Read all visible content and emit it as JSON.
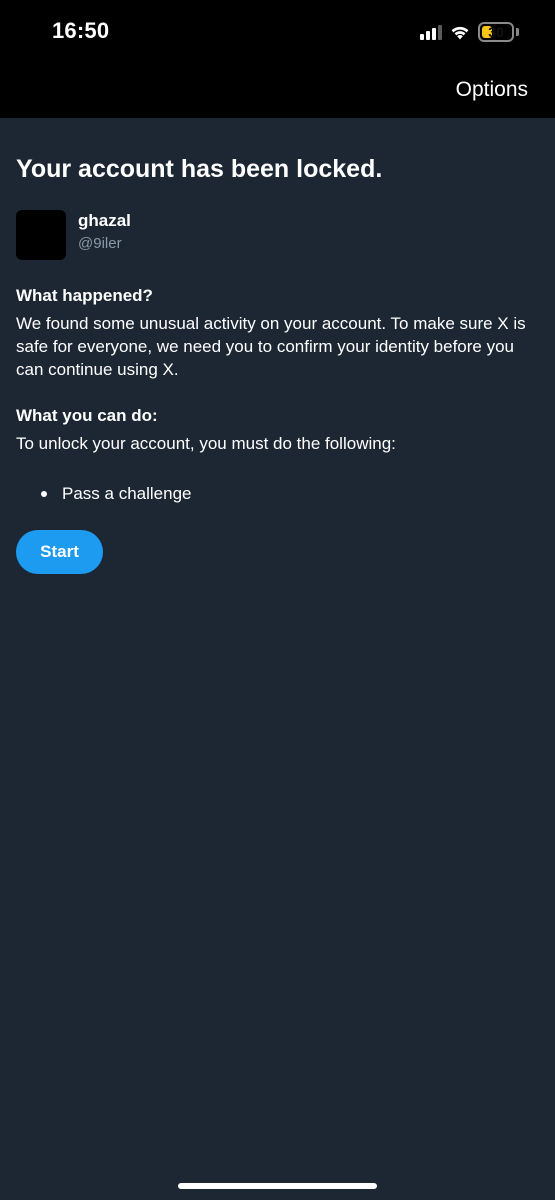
{
  "status_bar": {
    "time": "16:50",
    "battery_level": "30",
    "battery_color": "#f5c518",
    "icons": [
      "cellular-signal-icon",
      "wifi-icon",
      "battery-icon"
    ]
  },
  "nav": {
    "options_label": "Options"
  },
  "page": {
    "title": "Your account has been locked."
  },
  "account": {
    "display_name": "ghazal",
    "handle": "@9iler"
  },
  "what_happened": {
    "heading": "What happened?",
    "body": "We found some unusual activity on your account. To make sure X is safe for everyone, we need you to confirm your identity before you can continue using X."
  },
  "what_you_can_do": {
    "heading": "What you can do:",
    "body": "To unlock your account, you must do the following:",
    "steps": [
      "Pass a challenge"
    ]
  },
  "actions": {
    "start_label": "Start"
  },
  "colors": {
    "background": "#1c2733",
    "accent": "#1d9bf0",
    "secondary_text": "#8b98a5"
  }
}
